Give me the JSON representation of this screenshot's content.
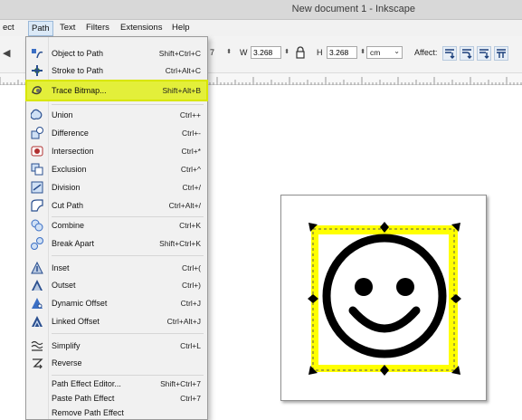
{
  "window": {
    "title": "New document 1 - Inkscape"
  },
  "menubar": [
    {
      "label": "ect"
    },
    {
      "label": "Path"
    },
    {
      "label": "Text"
    },
    {
      "label": "Filters"
    },
    {
      "label": "Extensions"
    },
    {
      "label": "Help"
    }
  ],
  "toolbar": {
    "x_value_partial": "7",
    "w_label": "W",
    "w_value": "3.268",
    "h_label": "H",
    "h_value": "3.268",
    "unit": "cm",
    "affect_label": "Affect:"
  },
  "path_menu": {
    "items": [
      {
        "label": "Object to Path",
        "shortcut": "Shift+Ctrl+C",
        "icon": "object-to-path-icon"
      },
      {
        "label": "Stroke to Path",
        "shortcut": "Ctrl+Alt+C",
        "icon": "stroke-to-path-icon"
      },
      {
        "label": "Trace Bitmap...",
        "shortcut": "Shift+Alt+B",
        "icon": "trace-bitmap-icon",
        "highlighted": true
      },
      {
        "label": "Union",
        "shortcut": "Ctrl++",
        "icon": "union-icon"
      },
      {
        "label": "Difference",
        "shortcut": "Ctrl+-",
        "icon": "difference-icon"
      },
      {
        "label": "Intersection",
        "shortcut": "Ctrl+*",
        "icon": "intersection-icon"
      },
      {
        "label": "Exclusion",
        "shortcut": "Ctrl+^",
        "icon": "exclusion-icon"
      },
      {
        "label": "Division",
        "shortcut": "Ctrl+/",
        "icon": "division-icon"
      },
      {
        "label": "Cut Path",
        "shortcut": "Ctrl+Alt+/",
        "icon": "cut-path-icon"
      },
      {
        "label": "Combine",
        "shortcut": "Ctrl+K",
        "icon": "combine-icon"
      },
      {
        "label": "Break Apart",
        "shortcut": "Shift+Ctrl+K",
        "icon": "break-apart-icon"
      },
      {
        "label": "Inset",
        "shortcut": "Ctrl+(",
        "icon": "inset-icon"
      },
      {
        "label": "Outset",
        "shortcut": "Ctrl+)",
        "icon": "outset-icon"
      },
      {
        "label": "Dynamic Offset",
        "shortcut": "Ctrl+J",
        "icon": "dynamic-offset-icon"
      },
      {
        "label": "Linked Offset",
        "shortcut": "Ctrl+Alt+J",
        "icon": "linked-offset-icon"
      },
      {
        "label": "Simplify",
        "shortcut": "Ctrl+L",
        "icon": "simplify-icon"
      },
      {
        "label": "Reverse",
        "shortcut": "",
        "icon": "reverse-icon"
      },
      {
        "label": "Path Effect Editor...",
        "shortcut": "Shift+Ctrl+7",
        "icon": ""
      },
      {
        "label": "Paste Path Effect",
        "shortcut": "Ctrl+7",
        "icon": ""
      },
      {
        "label": "Remove Path Effect",
        "shortcut": "",
        "icon": ""
      }
    ]
  },
  "colors": {
    "highlight": "#e3ef3a",
    "selection_yellow": "#ffff00"
  }
}
